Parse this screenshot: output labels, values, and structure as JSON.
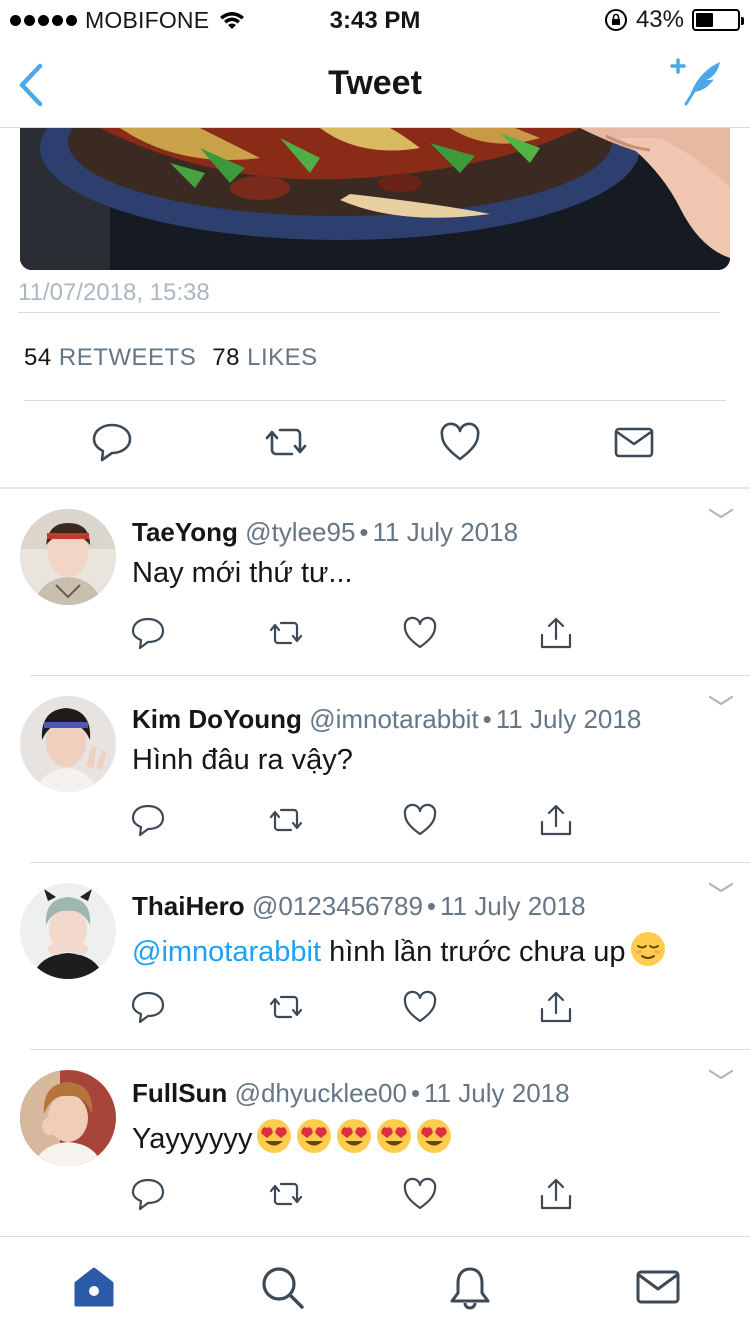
{
  "status_bar": {
    "carrier": "MOBIFONE",
    "time": "3:43 PM",
    "battery": "43%",
    "battery_level": 0.43
  },
  "nav": {
    "title": "Tweet",
    "back_icon": "chevron-left-icon",
    "compose_icon": "compose-tweet-icon"
  },
  "tweet": {
    "date": "11/07/2018, 15:38",
    "retweets_count": "54",
    "retweets_label": "RETWEETS",
    "likes_count": "78",
    "likes_label": "LIKES"
  },
  "replies": [
    {
      "name": "TaeYong",
      "handle": "@tylee95",
      "date": "11 July 2018",
      "text": "Nay mới thứ tư...",
      "mention": "",
      "emojis": ""
    },
    {
      "name": "Kim DoYoung",
      "handle": "@imnotarabbit",
      "date": "11 July 2018",
      "text": "Hình đâu ra vậy?",
      "mention": "",
      "emojis": ""
    },
    {
      "name": "ThaiHero",
      "handle": "@0123456789",
      "date": "11 July 2018",
      "text": " hình lần trước chưa up",
      "mention": "@imnotarabbit",
      "emojis": "relieved-face"
    },
    {
      "name": "FullSun",
      "handle": "@dhyucklee00",
      "date": "11 July 2018",
      "text": "Yayyyyyy",
      "mention": "",
      "emojis": "heart-eyes x5"
    }
  ],
  "reply_separator": "•",
  "colors": {
    "accent": "#1da1f2",
    "icon_blue": "#4aa8e8",
    "icon_gray": "#657786",
    "tab_active": "#2b5aa6",
    "tab_inactive": "#3d4a56",
    "muted_text": "#aab8c2"
  },
  "tabs": [
    {
      "icon": "home-icon",
      "active": true
    },
    {
      "icon": "search-icon",
      "active": false
    },
    {
      "icon": "notifications-icon",
      "active": false
    },
    {
      "icon": "messages-icon",
      "active": false
    }
  ]
}
